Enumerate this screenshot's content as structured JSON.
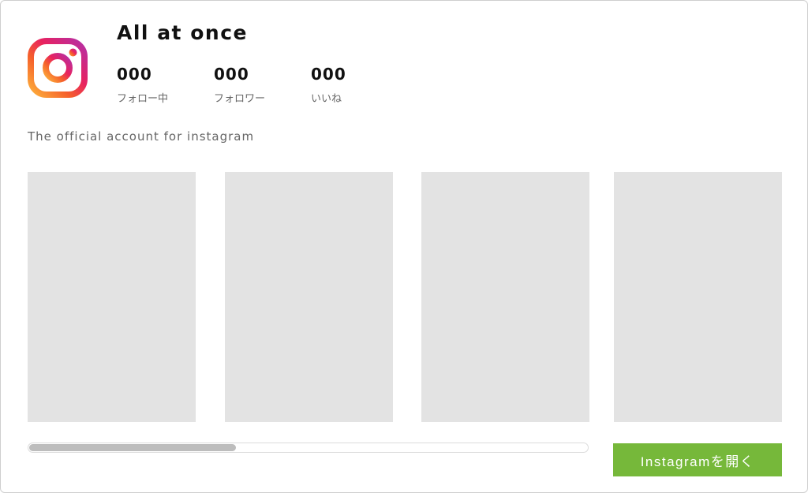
{
  "profile": {
    "name": "All at once",
    "logo_icon": "instagram-logo-icon",
    "bio": "The official account for instagram"
  },
  "stats": [
    {
      "value": "000",
      "label": "フォロー中"
    },
    {
      "value": "000",
      "label": "フォロワー"
    },
    {
      "value": "000",
      "label": "いいね"
    }
  ],
  "posts": [
    "",
    "",
    "",
    ""
  ],
  "scrollbar": {
    "position_fraction": 0.37
  },
  "actions": {
    "open_label": "Instagramを開く"
  },
  "colors": {
    "accent_button": "#76b83a",
    "placeholder": "#e3e3e3",
    "scroll_thumb": "#bdbdbd"
  }
}
